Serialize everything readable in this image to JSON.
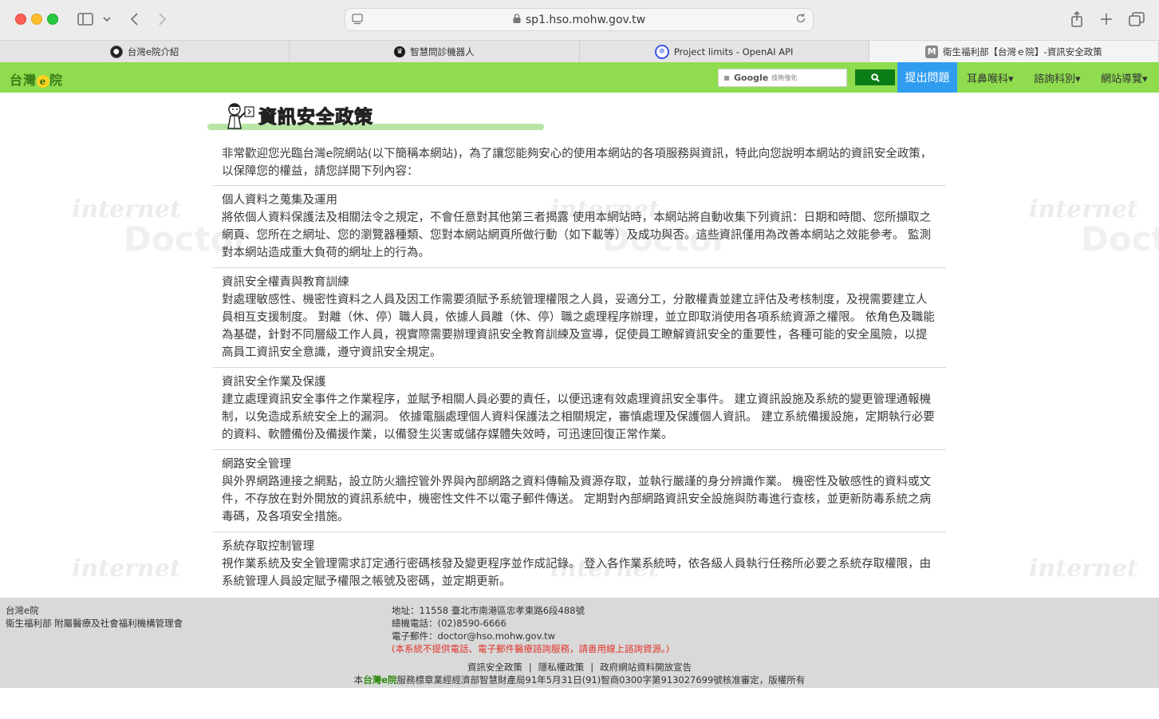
{
  "browser": {
    "url": "sp1.hso.mohw.gov.tw",
    "tabs": [
      {
        "label": "台灣e院介紹",
        "icon": "site-icon"
      },
      {
        "label": "智慧問診機器人",
        "icon": "robot-icon"
      },
      {
        "label": "Project limits - OpenAI API",
        "icon": "openai-icon"
      },
      {
        "label": "衛生福利部【台灣ｅ院】-資訊安全政策",
        "icon": "m-icon",
        "favicon_letter": "M"
      }
    ]
  },
  "site": {
    "logo": "台灣",
    "logo_e": "e",
    "logo_tail": "院",
    "google_label": "Google",
    "google_sub": "技術強化",
    "ask_button": "提出問題",
    "menus": [
      "耳鼻喉科▾",
      "諮詢科別▾",
      "網站導覽▾"
    ]
  },
  "watermark": {
    "text1": "internet",
    "text2": "Doctor"
  },
  "page": {
    "title": "資訊安全政策",
    "intro": "非常歡迎您光臨台灣e院網站(以下簡稱本網站)，為了讓您能夠安心的使用本網站的各項服務與資訊，特此向您說明本網站的資訊安全政策，以保障您的權益，請您詳閱下列內容：",
    "sections": [
      {
        "title": "個人資料之蒐集及運用",
        "body": "將依個人資料保護法及相關法令之規定，不會任意對其他第三者揭露 使用本網站時，本網站將自動收集下列資訊：日期和時間、您所擷取之網頁、您所在之網址、您的瀏覽器種類、您對本網站網頁所做行動（如下載等）及成功與否。這些資訊僅用為改善本網站之效能參考。 監測對本網站造成重大負荷的網址上的行為。"
      },
      {
        "title": "資訊安全權責與教育訓練",
        "body": "對處理敏感性、機密性資料之人員及因工作需要須賦予系統管理權限之人員，妥適分工，分散權責並建立評估及考核制度，及視需要建立人員相互支援制度。 對離（休、停）職人員，依據人員離（休、停）職之處理程序辦理，並立即取消使用各項系統資源之權限。 依角色及職能為基礎，針對不同層級工作人員，視實際需要辦理資訊安全教育訓練及宣導，促使員工瞭解資訊安全的重要性，各種可能的安全風險，以提高員工資訊安全意識，遵守資訊安全規定。"
      },
      {
        "title": "資訊安全作業及保護",
        "body": "建立處理資訊安全事件之作業程序，並賦予相關人員必要的責任，以便迅速有效處理資訊安全事件。 建立資訊設施及系統的變更管理通報機制，以免造成系統安全上的漏洞。 依據電腦處理個人資料保護法之相關規定，審慎處理及保護個人資訊。 建立系統備援設施，定期執行必要的資料、軟體備份及備援作業，以備發生災害或儲存媒體失效時，可迅速回復正常作業。"
      },
      {
        "title": "網路安全管理",
        "body": "與外界網路連接之網點，設立防火牆控管外界與內部網路之資料傳輸及資源存取，並執行嚴謹的身分辨識作業。 機密性及敏感性的資料或文件，不存放在對外開放的資訊系統中，機密性文件不以電子郵件傳送。 定期對內部網路資訊安全設施與防毒進行查核，並更新防毒系統之病毒碼，及各項安全措施。"
      },
      {
        "title": "系統存取控制管理",
        "body": "視作業系統及安全管理需求訂定通行密碼核發及變更程序並作成記錄。 登入各作業系統時，依各級人員執行任務所必要之系統存取權限，由系統管理人員設定賦予權限之帳號及密碼，並定期更新。"
      }
    ]
  },
  "footer": {
    "org_name": "台灣e院",
    "org_sub": "衛生福利部 附屬醫療及社會福利機構管理會",
    "address": "地址：11558 臺北市南港區忠孝東路6段488號",
    "phone": "總機電話：(02)8590-6666",
    "email": "電子郵件：doctor@hso.mohw.gov.tw",
    "notice": "(本系統不提供電話、電子郵件醫療諮詢服務，請善用線上諮詢資源。)",
    "links": [
      "資訊安全政策",
      "隱私權政策",
      "政府網站資料開放宣告"
    ],
    "copy_prefix": "本",
    "copy_brand": "台灣e院",
    "copy_text": "服務標章業經經濟部智慧財產局91年5月31日(91)智商0300字第913027699號核准審定，版權所有"
  }
}
